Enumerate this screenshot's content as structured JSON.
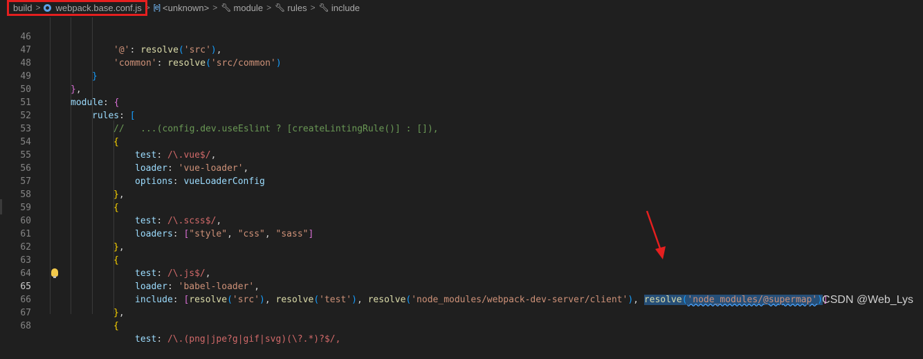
{
  "breadcrumb": {
    "items": [
      {
        "label": "build",
        "icon": ""
      },
      {
        "label": "webpack.base.conf.js",
        "icon": "js-file-icon"
      },
      {
        "label": "<unknown>",
        "icon": "variable-icon"
      },
      {
        "label": "module",
        "icon": "wrench-icon"
      },
      {
        "label": "rules",
        "icon": "wrench-icon"
      },
      {
        "label": "include",
        "icon": "wrench-icon"
      }
    ],
    "separator": ">"
  },
  "editor": {
    "active_line": "65",
    "lines": [
      {
        "n": "46"
      },
      {
        "n": "47"
      },
      {
        "n": "48"
      },
      {
        "n": "49"
      },
      {
        "n": "50"
      },
      {
        "n": "51"
      },
      {
        "n": "52"
      },
      {
        "n": "53"
      },
      {
        "n": "54"
      },
      {
        "n": "55"
      },
      {
        "n": "56"
      },
      {
        "n": "57"
      },
      {
        "n": "58"
      },
      {
        "n": "59"
      },
      {
        "n": "60"
      },
      {
        "n": "61"
      },
      {
        "n": "62"
      },
      {
        "n": "63"
      },
      {
        "n": "64"
      },
      {
        "n": "65"
      },
      {
        "n": "66"
      },
      {
        "n": "67"
      },
      {
        "n": "68"
      }
    ],
    "tokens": {
      "at": "'@'",
      "resolve": "resolve",
      "src": "'src'",
      "common_key": "'common'",
      "src_common": "'src/common'",
      "module": "module",
      "rules": "rules",
      "comment": "//   ...(config.dev.useEslint ? [createLintingRule()] : []),",
      "test": "test",
      "loader": "loader",
      "options": "options",
      "loaders": "loaders",
      "include": "include",
      "re_vue": "/\\.vue$/",
      "re_scss": "/\\.scss$/",
      "re_js": "/\\.js$/",
      "vue_loader": "'vue-loader'",
      "vueLoaderConfig": "vueLoaderConfig",
      "style": "\"style\"",
      "css": "\"css\"",
      "sass": "\"sass\"",
      "babel_loader": "'babel-loader'",
      "test_str": "'test'",
      "wds_client": "'node_modules/webpack-dev-server/client'",
      "supermap": "'node_modules/@supermap'",
      "partial68": "/\\.(png|jpe?g|gif|svg)(\\?.*)?$/,"
    }
  },
  "watermark": "CSDN @Web_Lys",
  "colors": {
    "background": "#1f1f1f",
    "highlight_box": "#e51f1f",
    "arrow": "#e51f1f",
    "selection": "#264f78"
  }
}
